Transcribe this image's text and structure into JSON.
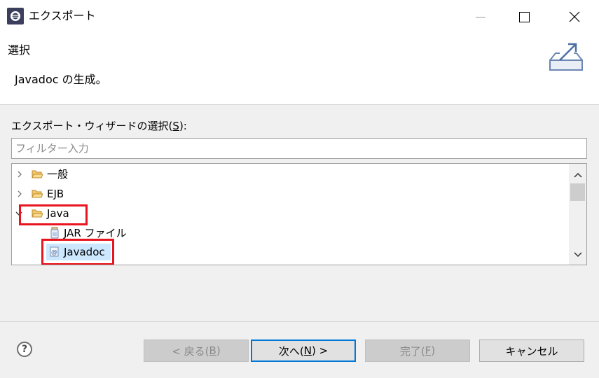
{
  "window": {
    "title": "エクスポート"
  },
  "banner": {
    "title": "選択",
    "description": "Javadoc の生成。"
  },
  "wizard_selection": {
    "label_prefix": "エクスポート・ウィザードの選択(",
    "label_mnemonic": "S",
    "label_suffix": "):",
    "filter_placeholder": "フィルター入力",
    "filter_value": ""
  },
  "tree": {
    "items": [
      {
        "label": "一般",
        "type": "folder",
        "expanded": false
      },
      {
        "label": "EJB",
        "type": "folder",
        "expanded": false
      },
      {
        "label": "Java",
        "type": "folder",
        "expanded": true
      },
      {
        "label": "JAR ファイル",
        "type": "jar"
      },
      {
        "label": "Javadoc",
        "type": "javadoc",
        "selected": true
      }
    ]
  },
  "buttons": {
    "back_prefix": "< 戻る(",
    "back_mnemonic": "B",
    "back_suffix": ")",
    "next_prefix": "次へ(",
    "next_mnemonic": "N",
    "next_suffix": ") >",
    "finish_prefix": "完了(",
    "finish_mnemonic": "F",
    "finish_suffix": ")",
    "cancel": "キャンセル"
  },
  "help": {
    "symbol": "?"
  },
  "colors": {
    "highlight": "#e8141e",
    "selection": "#cce8ff",
    "default_button_border": "#0078d7"
  }
}
